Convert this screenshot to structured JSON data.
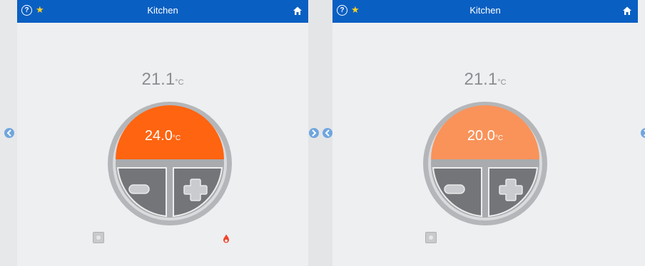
{
  "panels": [
    {
      "header": {
        "title": "Kitchen"
      },
      "current_temp": "21.1",
      "current_unit": "°C",
      "setpoint": "24.0",
      "setpoint_unit": "°C",
      "setpoint_color": "#ff6410",
      "heating_active": true
    },
    {
      "header": {
        "title": "Kitchen"
      },
      "current_temp": "21.1",
      "current_unit": "°C",
      "setpoint": "20.0",
      "setpoint_unit": "°C",
      "setpoint_color": "#f9935a",
      "heating_active": false
    }
  ],
  "icons": {
    "help": "?",
    "favorite": "★",
    "home": "home-icon",
    "next": "chevron-right-icon",
    "previous": "chevron-left-icon",
    "heating": "flame-icon"
  },
  "colors": {
    "header": "#0a5fc2",
    "favorite": "#ffd21f",
    "heating": "#f0442a",
    "nav_arrow": "#6fa6df"
  }
}
